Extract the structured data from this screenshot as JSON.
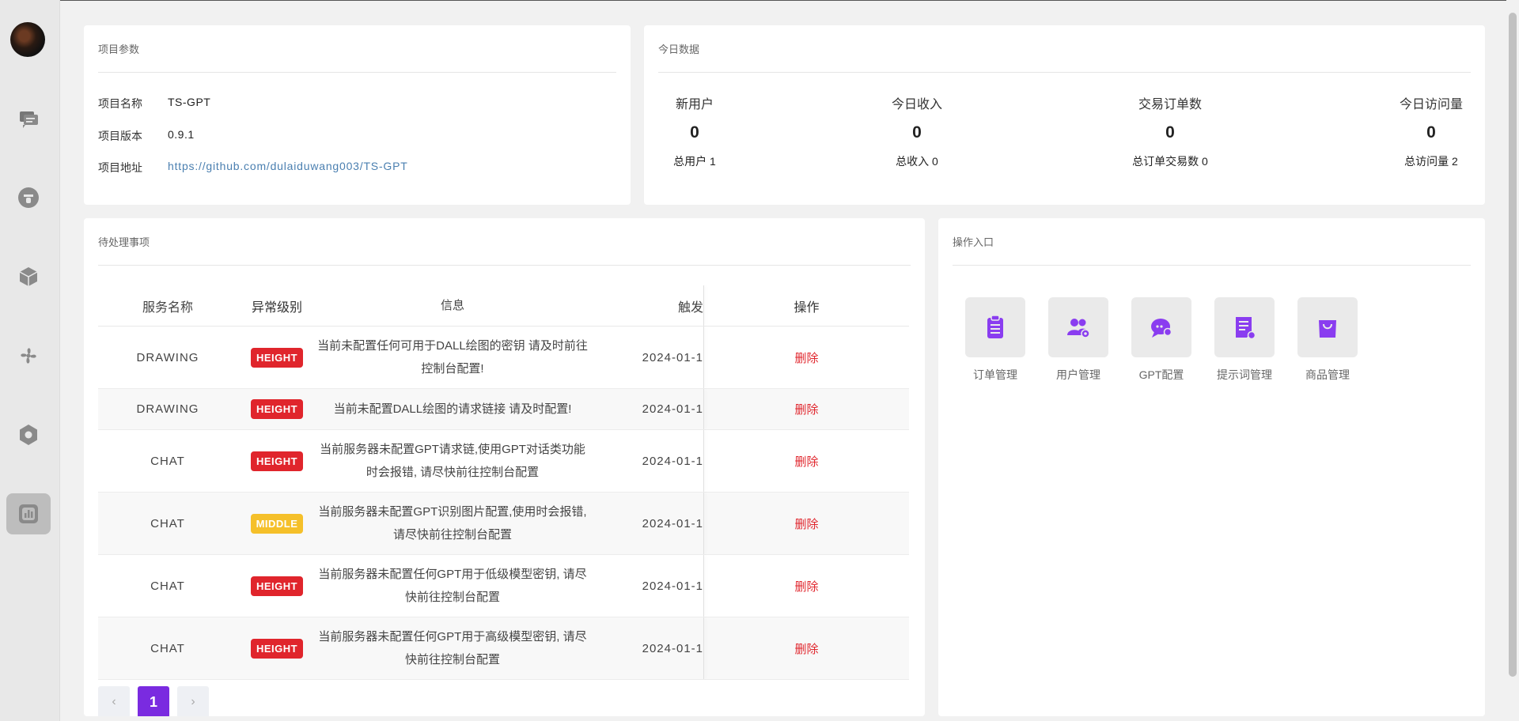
{
  "sidebar": {
    "icons": [
      "chat-icon",
      "robot-icon",
      "cube-icon",
      "fan-icon",
      "settings-icon",
      "dashboard-icon"
    ],
    "active": "dashboard-icon"
  },
  "project": {
    "title": "项目参数",
    "name_label": "项目名称",
    "name_value": "TS-GPT",
    "version_label": "项目版本",
    "version_value": "0.9.1",
    "url_label": "项目地址",
    "url_value": "https://github.com/dulaiduwang003/TS-GPT"
  },
  "today": {
    "title": "今日数据",
    "stats": [
      {
        "label": "新用户",
        "value": "0",
        "total": "总用户 1"
      },
      {
        "label": "今日收入",
        "value": "0",
        "total": "总收入 0"
      },
      {
        "label": "交易订单数",
        "value": "0",
        "total": "总订单交易数 0"
      },
      {
        "label": "今日访问量",
        "value": "0",
        "total": "总访问量 2"
      }
    ]
  },
  "pending": {
    "title": "待处理事项",
    "columns": [
      "服务名称",
      "异常级别",
      "信息",
      "触发",
      "操作"
    ],
    "rows": [
      {
        "name": "DRAWING",
        "level": "HEIGHT",
        "msg": "当前未配置任何可用于DALL绘图的密钥 请及时前往控制台配置!",
        "time": "2024-01-1",
        "op": "删除"
      },
      {
        "name": "DRAWING",
        "level": "HEIGHT",
        "msg": "当前未配置DALL绘图的请求链接 请及时配置!",
        "time": "2024-01-1",
        "op": "删除"
      },
      {
        "name": "CHAT",
        "level": "HEIGHT",
        "msg": "当前服务器未配置GPT请求链,使用GPT对话类功能时会报错, 请尽快前往控制台配置",
        "time": "2024-01-1",
        "op": "删除"
      },
      {
        "name": "CHAT",
        "level": "MIDDLE",
        "msg": "当前服务器未配置GPT识别图片配置,使用时会报错, 请尽快前往控制台配置",
        "time": "2024-01-1",
        "op": "删除"
      },
      {
        "name": "CHAT",
        "level": "HEIGHT",
        "msg": "当前服务器未配置任何GPT用于低级模型密钥, 请尽快前往控制台配置",
        "time": "2024-01-1",
        "op": "删除"
      },
      {
        "name": "CHAT",
        "level": "HEIGHT",
        "msg": "当前服务器未配置任何GPT用于高级模型密钥, 请尽快前往控制台配置",
        "time": "2024-01-1",
        "op": "删除"
      }
    ],
    "pager": {
      "prev": "‹",
      "current": "1",
      "next": "›"
    }
  },
  "entries": {
    "title": "操作入口",
    "items": [
      {
        "label": "订单管理",
        "icon": "clipboard-icon"
      },
      {
        "label": "用户管理",
        "icon": "users-icon"
      },
      {
        "label": "GPT配置",
        "icon": "chat-bubble-icon"
      },
      {
        "label": "提示词管理",
        "icon": "prompt-doc-icon"
      },
      {
        "label": "商品管理",
        "icon": "shopping-bag-icon"
      }
    ]
  },
  "colors": {
    "accent": "#7a2be0",
    "danger": "#e0252c",
    "warning": "#f5c02a",
    "link": "#4a7fb0"
  }
}
